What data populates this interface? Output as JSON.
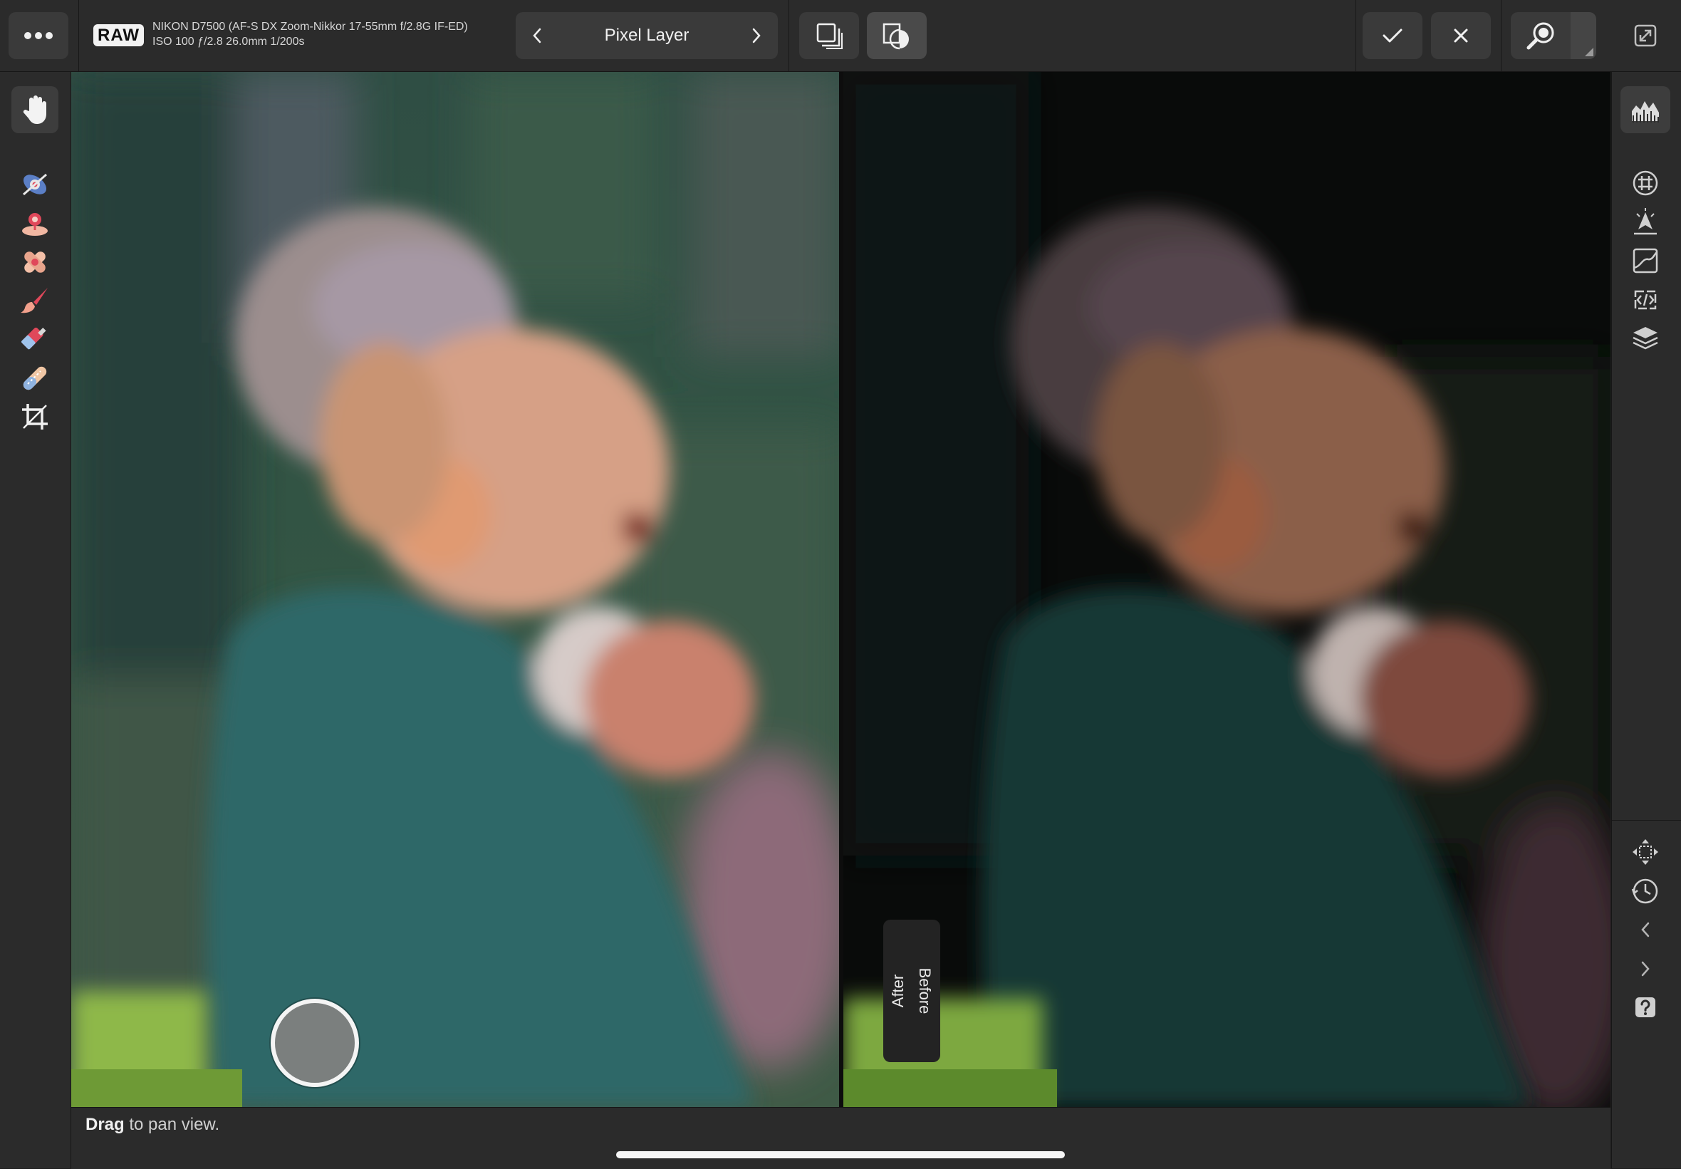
{
  "topbar": {
    "raw_badge": "RAW",
    "camera_line1": "NIKON D7500 (AF-S DX Zoom-Nikkor 17-55mm f/2.8G IF-ED)",
    "camera_line2": "ISO 100 ƒ/2.8 26.0mm 1/200s",
    "layer_title": "Pixel Layer",
    "menu_icon": "ellipsis-icon",
    "layer_prev_icon": "chevron-left-icon",
    "layer_next_icon": "chevron-right-icon",
    "overlay_icon": "overlay-stack-icon",
    "split_icon": "before-after-icon",
    "apply_icon": "check-icon",
    "cancel_icon": "close-icon",
    "zoom_icon": "zoom-icon",
    "fullscreen_icon": "fullscreen-icon"
  },
  "left_tools": [
    {
      "name": "hand-tool",
      "icon": "hand-icon",
      "active": true
    },
    {
      "name": "red-eye-tool",
      "icon": "red-eye-icon",
      "active": false
    },
    {
      "name": "blemish-tool",
      "icon": "blemish-icon",
      "active": false
    },
    {
      "name": "inpainting-tool",
      "icon": "bandage-icon",
      "active": false
    },
    {
      "name": "paint-brush-tool",
      "icon": "brush-icon",
      "active": false
    },
    {
      "name": "erase-brush-tool",
      "icon": "eraser-icon",
      "active": false
    },
    {
      "name": "gradient-tool",
      "icon": "gradient-icon",
      "active": false
    },
    {
      "name": "crop-tool",
      "icon": "crop-icon",
      "active": false
    }
  ],
  "right_panels": [
    {
      "name": "histogram-panel",
      "icon": "histogram-icon",
      "active": true
    },
    {
      "name": "navigator-panel",
      "icon": "grid-icon",
      "active": false
    },
    {
      "name": "presets-panel",
      "icon": "presets-icon",
      "active": false
    },
    {
      "name": "tone-curve-panel",
      "icon": "curve-icon",
      "active": false
    },
    {
      "name": "scope-panel",
      "icon": "code-icon",
      "active": false
    },
    {
      "name": "layers-panel",
      "icon": "layers-icon",
      "active": false
    },
    {
      "name": "transform-panel",
      "icon": "move-icon",
      "active": false
    },
    {
      "name": "history-panel",
      "icon": "history-icon",
      "active": false
    },
    {
      "name": "undo-panel",
      "icon": "chevron-left-icon",
      "active": false
    },
    {
      "name": "redo-panel",
      "icon": "chevron-right-icon",
      "active": false
    },
    {
      "name": "help-panel",
      "icon": "help-icon",
      "active": false
    }
  ],
  "canvas": {
    "after_label": "After",
    "before_label": "Before"
  },
  "status": {
    "hint_bold": "Drag",
    "hint_rest": " to pan view."
  },
  "colors": {
    "bar_bg": "#2b2b2b",
    "button_bg": "#3a3a3a",
    "active_bg": "#3d3d3d",
    "accent_red": "#e0485a"
  }
}
